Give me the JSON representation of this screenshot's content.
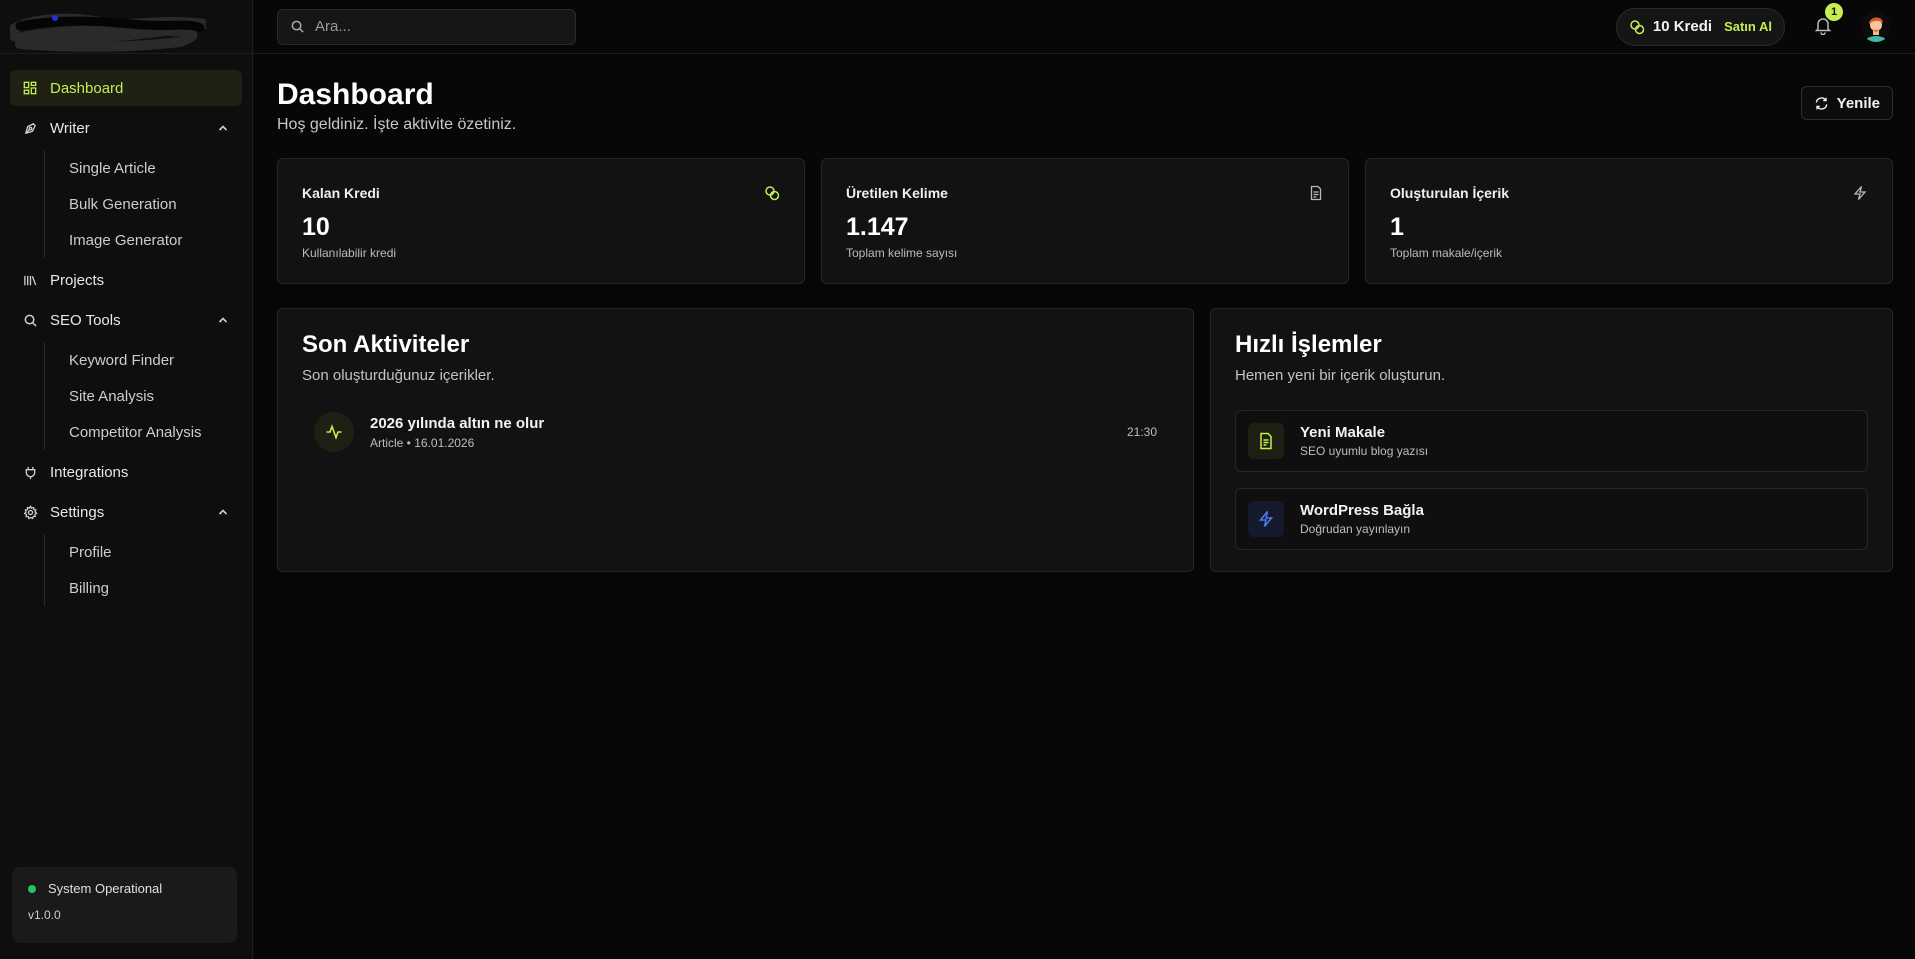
{
  "colors": {
    "accent": "#c5ee52",
    "background": "#070707",
    "panel": "#121212",
    "status_ok": "#22c55e",
    "blue": "#4f7bf0"
  },
  "sidebar": {
    "items": [
      {
        "label": "Dashboard",
        "icon": "grid-icon",
        "active": true
      },
      {
        "label": "Writer",
        "icon": "pen-icon",
        "expanded": true,
        "children": [
          "Single Article",
          "Bulk Generation",
          "Image Generator"
        ]
      },
      {
        "label": "Projects",
        "icon": "library-icon"
      },
      {
        "label": "SEO Tools",
        "icon": "search-icon",
        "expanded": true,
        "children": [
          "Keyword Finder",
          "Site Analysis",
          "Competitor Analysis"
        ]
      },
      {
        "label": "Integrations",
        "icon": "plug-icon"
      },
      {
        "label": "Settings",
        "icon": "gear-icon",
        "expanded": true,
        "children": [
          "Profile",
          "Billing"
        ]
      }
    ],
    "status": {
      "label": "System Operational",
      "version": "v1.0.0"
    }
  },
  "topbar": {
    "search_placeholder": "Ara...",
    "credits": "10 Kredi",
    "buy_label": "Satın Al",
    "notification_count": "1"
  },
  "header": {
    "title": "Dashboard",
    "subtitle": "Hoş geldiniz. İşte aktivite özetiniz.",
    "refresh_label": "Yenile"
  },
  "stats": [
    {
      "label": "Kalan Kredi",
      "value": "10",
      "desc": "Kullanılabilir kredi",
      "icon": "coins-icon"
    },
    {
      "label": "Üretilen Kelime",
      "value": "1.147",
      "desc": "Toplam kelime sayısı",
      "icon": "document-icon"
    },
    {
      "label": "Oluşturulan İçerik",
      "value": "1",
      "desc": "Toplam makale/içerik",
      "icon": "lightning-icon"
    }
  ],
  "activity": {
    "title": "Son Aktiviteler",
    "subtitle": "Son oluşturduğunuz içerikler.",
    "items": [
      {
        "title": "2026 yılında altın ne olur",
        "meta": "Article • 16.01.2026",
        "time": "21:30",
        "icon": "activity-icon"
      }
    ]
  },
  "quick": {
    "title": "Hızlı İşlemler",
    "subtitle": "Hemen yeni bir içerik oluşturun.",
    "items": [
      {
        "title": "Yeni Makale",
        "desc": "SEO uyumlu blog yazısı",
        "icon": "file-text-icon"
      },
      {
        "title": "WordPress Bağla",
        "desc": "Doğrudan yayınlayın",
        "icon": "lightning-icon"
      }
    ]
  }
}
